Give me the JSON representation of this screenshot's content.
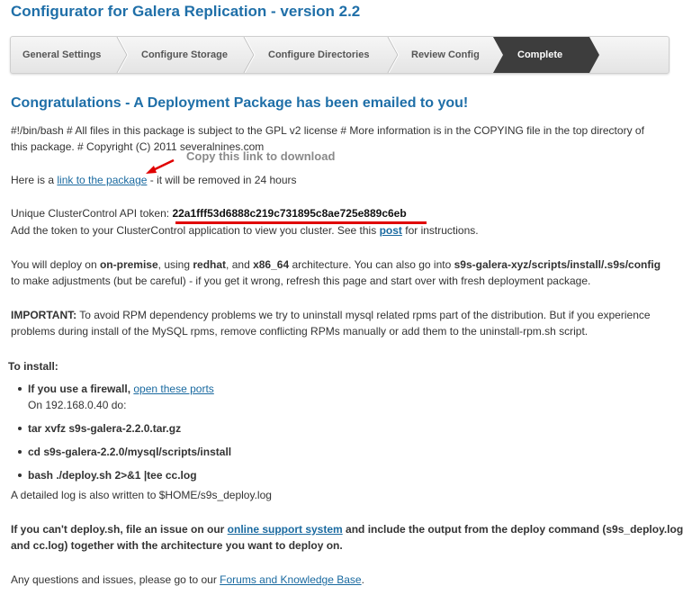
{
  "page_title": "Configurator for Galera Replication - version 2.2",
  "wizard": {
    "steps": [
      "General Settings",
      "Configure Storage",
      "Configure Directories",
      "Review Config"
    ],
    "active_step": "Complete"
  },
  "heading": "Congratulations - A Deployment Package has been emailed to you!",
  "license": {
    "line1": "#!/bin/bash # All files in this package is subject to the GPL v2 license # More information is in the COPYING file in the top directory of",
    "line2": "this package. # Copyright (C) 2011 severalnines.com"
  },
  "annotation": {
    "copy_hint": "Copy this link to download"
  },
  "package": {
    "prefix": "Here is a ",
    "link": "link to the package",
    "suffix": " - it will be removed in 24 hours"
  },
  "token": {
    "label": "Unique ClusterControl API token: ",
    "value": "22a1fff53d6888c219c731895c8ae725e889c6eb",
    "add_prefix": "Add the token to your ClusterControl application to view you cluster. See this ",
    "post_link": "post",
    "add_suffix": " for instructions."
  },
  "deploy": {
    "p1": "You will deploy on ",
    "env": "on-premise",
    "p2": ", using ",
    "os": "redhat",
    "p3": ", and ",
    "arch": "x86_64",
    "p4": " architecture. You can also go into ",
    "path": "s9s-galera-xyz/scripts/install/.s9s/config",
    "line2": "to make adjustments (but be careful) - if you get it wrong, refresh this page and start over with fresh deployment package."
  },
  "important": {
    "label": "IMPORTANT:",
    "line1": " To avoid RPM dependency problems we try to uninstall mysql related rpms part of the distribution. But if you experience",
    "line2": "problems during install of the MySQL rpms, remove conflicting RPMs manually or add them to the uninstall-rpm.sh script."
  },
  "install": {
    "title": "To install:",
    "firewall_prefix": "If you use a firewall, ",
    "firewall_link": "open these ports",
    "on_host": "On 192.168.0.40 do:",
    "steps": [
      "tar xvfz s9s-galera-2.2.0.tar.gz",
      "cd s9s-galera-2.2.0/mysql/scripts/install",
      "bash ./deploy.sh 2>&1 |tee cc.log"
    ],
    "log_note": "A detailed log is also written to $HOME/s9s_deploy.log"
  },
  "support": {
    "prefix": "If you can't deploy.sh, file an issue on our ",
    "link": "online support system",
    "suffix": " and include the output from the deploy command (s9s_deploy.log",
    "line2": "and cc.log) together with the architecture you want to deploy on."
  },
  "questions": {
    "prefix": "Any questions and issues, please go to our ",
    "link": "Forums and Knowledge Base",
    "suffix": "."
  }
}
